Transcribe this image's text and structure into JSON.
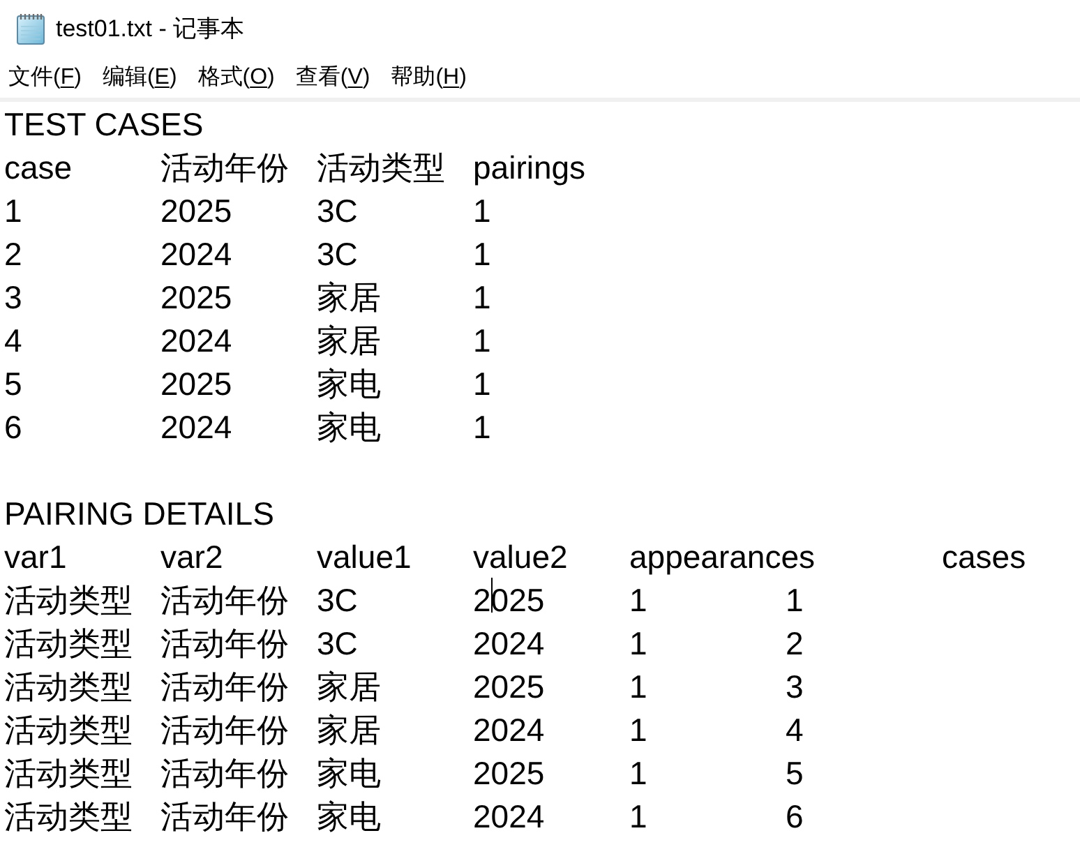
{
  "window": {
    "title": "test01.txt - 记事本"
  },
  "menu": [
    {
      "prefix": "文件(",
      "access_key": "F",
      "suffix": ")"
    },
    {
      "prefix": "编辑(",
      "access_key": "E",
      "suffix": ")"
    },
    {
      "prefix": "格式(",
      "access_key": "O",
      "suffix": ")"
    },
    {
      "prefix": "查看(",
      "access_key": "V",
      "suffix": ")"
    },
    {
      "prefix": "帮助(",
      "access_key": "H",
      "suffix": ")"
    }
  ],
  "document": {
    "sections": [
      {
        "heading": "TEST CASES",
        "columns": [
          "case",
          "活动年份",
          "活动类型",
          "pairings"
        ],
        "rows": [
          {
            "cells": [
              {
                "text": "1",
                "caret": false
              },
              {
                "text": "2025",
                "caret": false
              },
              {
                "text": "3C",
                "caret": false
              },
              {
                "text": "1",
                "caret": false
              }
            ]
          },
          {
            "cells": [
              {
                "text": "2",
                "caret": false
              },
              {
                "text": "2024",
                "caret": false
              },
              {
                "text": "3C",
                "caret": false
              },
              {
                "text": "1",
                "caret": false
              }
            ]
          },
          {
            "cells": [
              {
                "text": "3",
                "caret": false
              },
              {
                "text": "2025",
                "caret": false
              },
              {
                "text": "家居",
                "caret": false
              },
              {
                "text": "1",
                "caret": false
              }
            ]
          },
          {
            "cells": [
              {
                "text": "4",
                "caret": false
              },
              {
                "text": "2024",
                "caret": false
              },
              {
                "text": "家居",
                "caret": false
              },
              {
                "text": "1",
                "caret": false
              }
            ]
          },
          {
            "cells": [
              {
                "text": "5",
                "caret": false
              },
              {
                "text": "2025",
                "caret": false
              },
              {
                "text": "家电",
                "caret": false
              },
              {
                "text": "1",
                "caret": false
              }
            ]
          },
          {
            "cells": [
              {
                "text": "6",
                "caret": false
              },
              {
                "text": "2024",
                "caret": false
              },
              {
                "text": "家电",
                "caret": false
              },
              {
                "text": "1",
                "caret": false
              }
            ]
          }
        ]
      },
      {
        "heading": "PAIRING DETAILS",
        "columns": [
          "var1",
          "var2",
          "value1",
          "value2",
          "appearances",
          "cases"
        ],
        "rows": [
          {
            "cells": [
              {
                "text": "活动类型",
                "caret": false
              },
              {
                "text": "活动年份",
                "caret": false
              },
              {
                "text": "3C",
                "caret": false
              },
              {
                "text": "2025",
                "caret": true
              },
              {
                "text": "1",
                "caret": false
              },
              {
                "text": "1",
                "caret": false
              }
            ]
          },
          {
            "cells": [
              {
                "text": "活动类型",
                "caret": false
              },
              {
                "text": "活动年份",
                "caret": false
              },
              {
                "text": "3C",
                "caret": false
              },
              {
                "text": "2024",
                "caret": false
              },
              {
                "text": "1",
                "caret": false
              },
              {
                "text": "2",
                "caret": false
              }
            ]
          },
          {
            "cells": [
              {
                "text": "活动类型",
                "caret": false
              },
              {
                "text": "活动年份",
                "caret": false
              },
              {
                "text": "家居",
                "caret": false
              },
              {
                "text": "2025",
                "caret": false
              },
              {
                "text": "1",
                "caret": false
              },
              {
                "text": "3",
                "caret": false
              }
            ]
          },
          {
            "cells": [
              {
                "text": "活动类型",
                "caret": false
              },
              {
                "text": "活动年份",
                "caret": false
              },
              {
                "text": "家居",
                "caret": false
              },
              {
                "text": "2024",
                "caret": false
              },
              {
                "text": "1",
                "caret": false
              },
              {
                "text": "4",
                "caret": false
              }
            ]
          },
          {
            "cells": [
              {
                "text": "活动类型",
                "caret": false
              },
              {
                "text": "活动年份",
                "caret": false
              },
              {
                "text": "家电",
                "caret": false
              },
              {
                "text": "2025",
                "caret": false
              },
              {
                "text": "1",
                "caret": false
              },
              {
                "text": "5",
                "caret": false
              }
            ]
          },
          {
            "cells": [
              {
                "text": "活动类型",
                "caret": false
              },
              {
                "text": "活动年份",
                "caret": false
              },
              {
                "text": "家电",
                "caret": false
              },
              {
                "text": "2024",
                "caret": false
              },
              {
                "text": "1",
                "caret": false
              },
              {
                "text": "6",
                "caret": false
              }
            ]
          }
        ]
      }
    ]
  }
}
